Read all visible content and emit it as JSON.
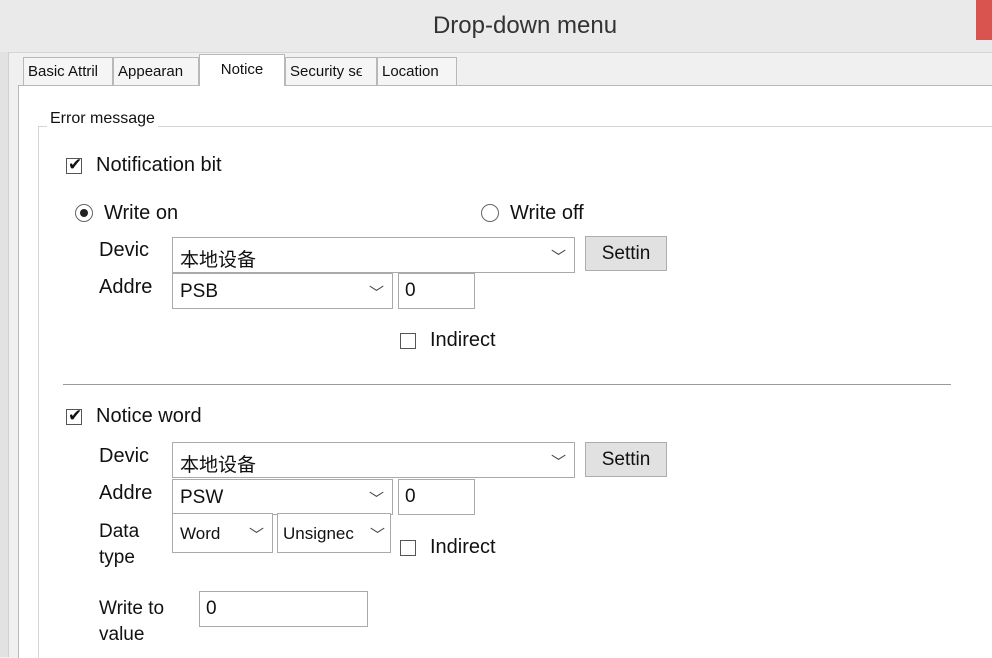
{
  "window": {
    "title": "Drop-down menu"
  },
  "tabs": [
    {
      "label": "Basic Attril"
    },
    {
      "label": "Appearan"
    },
    {
      "label": "Notice"
    },
    {
      "label": "Security sϵ"
    },
    {
      "label": "Location"
    }
  ],
  "group": {
    "label": "Error message"
  },
  "notification_bit": {
    "label": "Notification bit",
    "checked": true,
    "write_on_label": "Write on",
    "write_off_label": "Write off",
    "selected": "Write on",
    "device_label": "Devic",
    "device_value": "本地设备",
    "settings_label": "Settin",
    "address_label": "Addre",
    "address_type": "PSB",
    "address_value": "0",
    "indirect_label": "Indirect",
    "indirect_checked": false
  },
  "notice_word": {
    "label": "Notice word",
    "checked": true,
    "device_label": "Devic",
    "device_value": "本地设备",
    "settings_label": "Settin",
    "address_label": "Addre",
    "address_type": "PSW",
    "address_value": "0",
    "data_type_label_1": "Data",
    "data_type_label_2": "type",
    "data_type_value": "Word",
    "sign_value": "Unsignec",
    "indirect_label": "Indirect",
    "indirect_checked": false,
    "write_value_label_1": "Write to",
    "write_value_label_2": "value",
    "write_value": "0"
  },
  "icons": {
    "dropdown_arrow": "chevron-down-icon",
    "check": "checkmark-icon",
    "radio": "radio-dot-icon"
  }
}
